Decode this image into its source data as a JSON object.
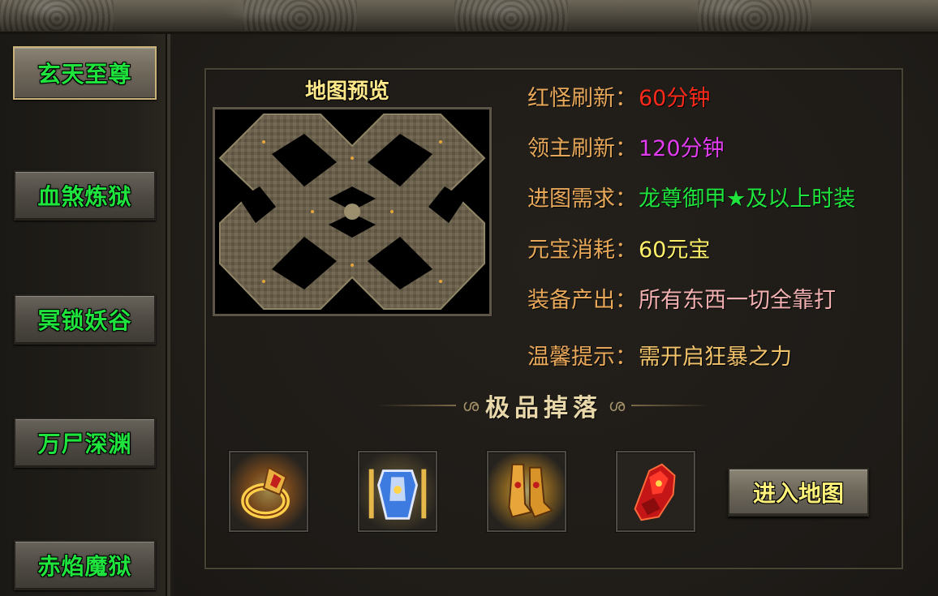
{
  "sidebar": {
    "items": [
      {
        "label": "玄天至尊",
        "active": true
      },
      {
        "label": "血煞炼狱",
        "active": false
      },
      {
        "label": "冥锁妖谷",
        "active": false
      },
      {
        "label": "万尸深渊",
        "active": false
      },
      {
        "label": "赤焰魔狱",
        "active": false
      }
    ]
  },
  "map_preview": {
    "title": "地图预览"
  },
  "info": {
    "red_monster_refresh": {
      "label": "红怪刷新：",
      "value": "60分钟",
      "color": "#ff2a1a"
    },
    "boss_refresh": {
      "label": "领主刷新：",
      "value": "120分钟",
      "color": "#e23cf0"
    },
    "entry_requirement": {
      "label": "进图需求：",
      "value": "龙尊御甲★及以上时装",
      "color": "#1fe43d"
    },
    "yuanbao_cost": {
      "label": "元宝消耗：",
      "value": "60元宝",
      "color": "#fff06a"
    },
    "equipment_drop": {
      "label": "装备产出：",
      "value": "所有东西一切全靠打",
      "color": "#f3b0b0"
    },
    "tip": {
      "label": "温馨提示：",
      "value": "需开启狂暴之力",
      "color": "#f2c36a"
    }
  },
  "drops": {
    "heading": "极品掉落",
    "items": [
      {
        "icon": "gold-ring-icon"
      },
      {
        "icon": "blue-armor-icon"
      },
      {
        "icon": "golden-boots-icon"
      },
      {
        "icon": "red-gauntlet-icon"
      }
    ]
  },
  "enter_button": {
    "label": "进入地图"
  },
  "colors": {
    "label": "#e8a85a",
    "nav_text": "#1fe43d",
    "title_text": "#ffe98a"
  }
}
